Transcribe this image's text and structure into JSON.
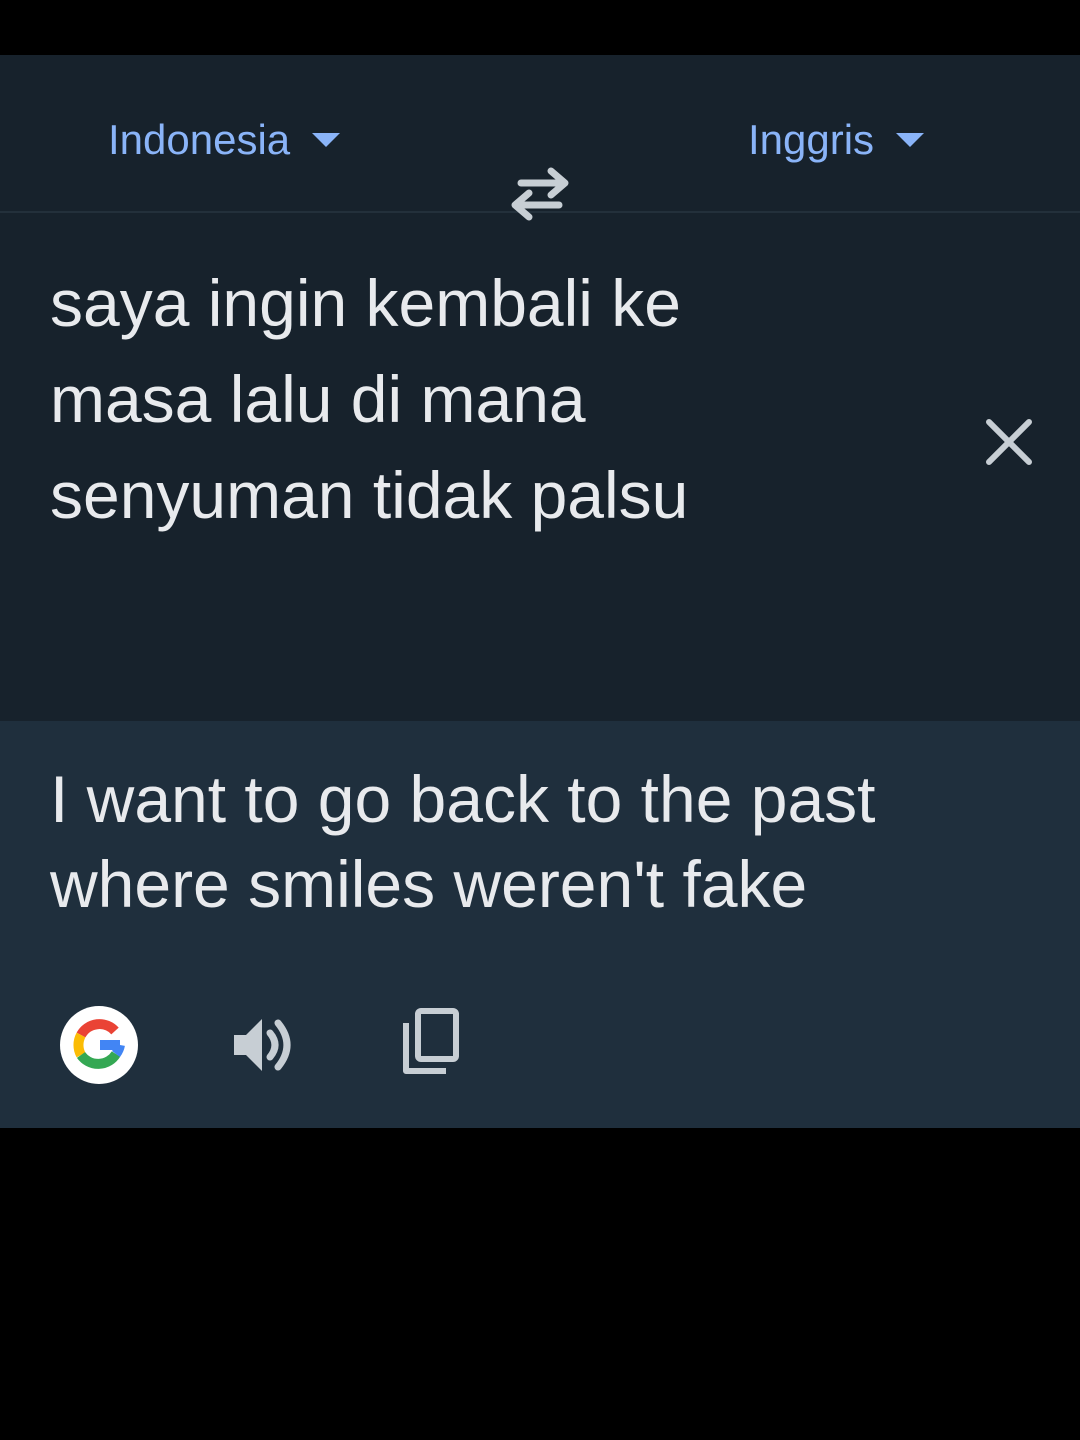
{
  "languages": {
    "source": "Indonesia",
    "target": "Inggris"
  },
  "input": {
    "text": "saya ingin kembali ke\nmasa lalu di mana\nsenyuman tidak palsu"
  },
  "output": {
    "text": "I want to go back to the past\nwhere smiles weren't fake"
  },
  "icons": {
    "source_dropdown": "caret-down-icon",
    "target_dropdown": "caret-down-icon",
    "swap": "swap-arrows-icon",
    "clear": "close-icon",
    "listen_source": "speaker-icon",
    "camera": "camera-icon",
    "google": "google-logo-icon",
    "listen_result": "speaker-icon",
    "copy": "copy-icon"
  },
  "colors": {
    "background": "#000000",
    "panel": "#17222c",
    "result_panel": "#1f2f3d",
    "accent": "#8ab4f8",
    "text": "#e8eaed",
    "icon": "#c7ced4"
  }
}
